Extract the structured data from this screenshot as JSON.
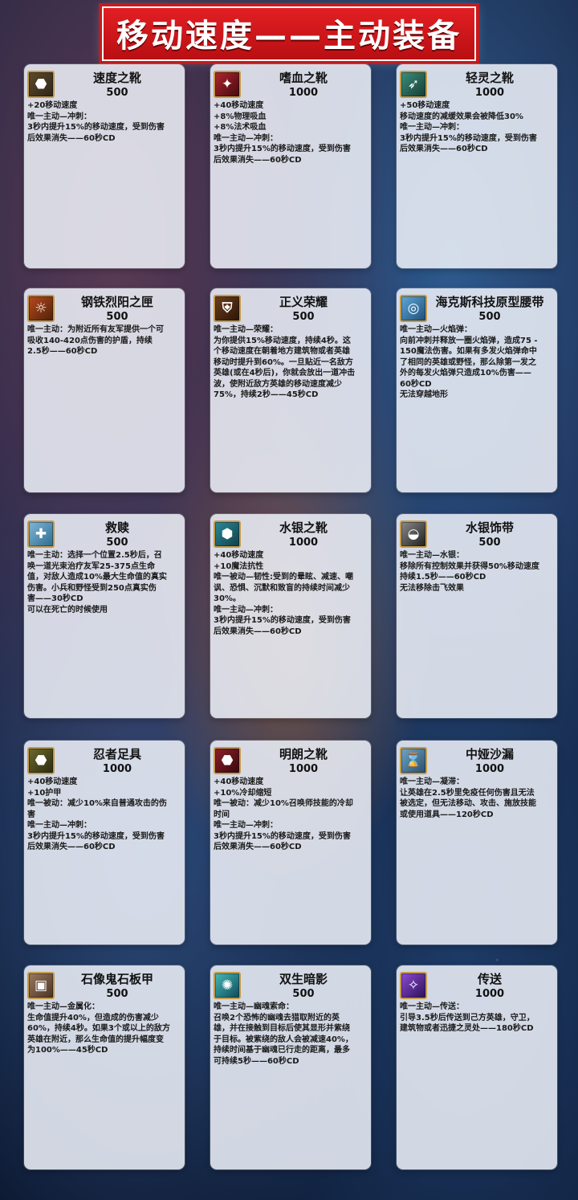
{
  "title": "移动速度——主动装备",
  "cards": [
    {
      "name": "速度之靴",
      "price": "500",
      "icon": "boot-icon",
      "desc": [
        "+20移动速度",
        "唯一主动—冲刺：",
        "3秒内提升15%的移动速度，受到伤害",
        "后效果消失——60秒CD"
      ]
    },
    {
      "name": "嗜血之靴",
      "price": "1000",
      "icon": "blood-boot-icon",
      "desc": [
        "+40移动速度",
        "+8%物理吸血",
        "+8%法术吸血",
        "唯一主动—冲刺：",
        "3秒内提升15%的移动速度，受到伤害",
        "后效果消失——60秒CD"
      ]
    },
    {
      "name": "轻灵之靴",
      "price": "1000",
      "icon": "light-boot-icon",
      "desc": [
        "+50移动速度",
        "移动速度的减缓效果会被降低30%",
        "唯一主动—冲刺：",
        "3秒内提升15%的移动速度，受到伤害",
        "后效果消失——60秒CD"
      ]
    },
    {
      "name": "钢铁烈阳之匣",
      "price": "500",
      "icon": "sun-shield-icon",
      "desc": [
        "唯一主动：为附近所有友军提供一个可",
        "吸收140-420点伤害的护盾，持续",
        "2.5秒——60秒CD"
      ]
    },
    {
      "name": "正义荣耀",
      "price": "500",
      "icon": "helm-icon",
      "desc": [
        "唯一主动—荣耀：",
        "为你提供15%移动速度，持续4秒。这",
        "个移动速度在朝着地方建筑物或者英雄",
        "移动时提升到60%。一旦贴近一名敌方",
        "英雄(或在4秒后)，你就会放出一道冲击",
        "波，使附近敌方英雄的移动速度减少",
        "75%，持续2秒——45秒CD"
      ]
    },
    {
      "name": "海克斯科技原型腰带",
      "price": "500",
      "icon": "belt-icon",
      "desc": [
        "唯一主动—火焰弹：",
        "向前冲刺并释放一圈火焰弹，造成75 -",
        "150魔法伤害。如果有多发火焰弹命中",
        "了相同的英雄或野怪，那么除第一发之",
        "外的每发火焰弹只造成10%伤害——",
        "60秒CD",
        "无法穿越地形"
      ]
    },
    {
      "name": "救赎",
      "price": "500",
      "icon": "redemption-icon",
      "desc": [
        "唯一主动：选择一个位置2.5秒后，召",
        "唤一道光束治疗友军25-375点生命",
        "值，对敌人造成10%最大生命值的真实",
        "伤害。小兵和野怪受到250点真实伤",
        "害——30秒CD",
        "可以在死亡的时候使用"
      ]
    },
    {
      "name": "水银之靴",
      "price": "1000",
      "icon": "mercury-boot-icon",
      "desc": [
        "+40移动速度",
        "+10魔法抗性",
        "唯一被动—韧性:受到的晕眩、减速、嘲",
        "讽、恐惧、沉默和致盲的持续时间减少",
        "30%。",
        "唯一主动—冲刺：",
        "3秒内提升15%的移动速度，受到伤害",
        "后效果消失——60秒CD"
      ]
    },
    {
      "name": "水银饰带",
      "price": "500",
      "icon": "sash-icon",
      "desc": [
        "唯一主动—水银：",
        "移除所有控制效果并获得50%移动速度",
        "持续1.5秒——60秒CD",
        "无法移除击飞效果"
      ]
    },
    {
      "name": "忍者足具",
      "price": "1000",
      "icon": "ninja-boot-icon",
      "desc": [
        "+40移动速度",
        "+10护甲",
        "唯一被动：减少10%来自普通攻击的伤",
        "害",
        "唯一主动—冲刺：",
        "3秒内提升15%的移动速度，受到伤害",
        "后效果消失——60秒CD"
      ]
    },
    {
      "name": "明朗之靴",
      "price": "1000",
      "icon": "lucid-boot-icon",
      "desc": [
        "+40移动速度",
        "+10%冷却缩短",
        "唯一被动：减少10%召唤师技能的冷却",
        "时间",
        "唯一主动—冲刺：",
        "3秒内提升15%的移动速度，受到伤害",
        "后效果消失——60秒CD"
      ]
    },
    {
      "name": "中娅沙漏",
      "price": "1000",
      "icon": "hourglass-icon",
      "desc": [
        "唯一主动—凝滞：",
        "让英雄在2.5秒里免疫任何伤害且无法",
        "被选定，但无法移动、攻击、施放技能",
        "或使用道具——120秒CD"
      ]
    },
    {
      "name": "石像鬼石板甲",
      "price": "500",
      "icon": "stone-armor-icon",
      "desc": [
        "唯一主动—金属化：",
        "生命值提升40%，但造成的伤害减少",
        "60%，持续4秒。如果3个或以上的敌方",
        "英雄在附近，那么生命值的提升幅度变",
        "为100%——45秒CD"
      ]
    },
    {
      "name": "双生暗影",
      "price": "500",
      "icon": "twin-shadow-icon",
      "desc": [
        "唯一主动—幽魂索命：",
        "召唤2个恐怖的幽魂去猎取附近的英",
        "雄，并在接触到目标后使其显形并紫绕",
        "于目标。被紫绕的敌人会被减速40%，",
        "持续时间基于幽魂已行走的距离，最多",
        "可持续5秒——60秒CD"
      ]
    },
    {
      "name": "传送",
      "price": "1000",
      "icon": "teleport-icon",
      "desc": [
        "唯一主动—传送：",
        "引导3.5秒后传送到己方英雄，守卫，",
        "建筑物或者迅捷之灵处——180秒CD"
      ]
    }
  ]
}
